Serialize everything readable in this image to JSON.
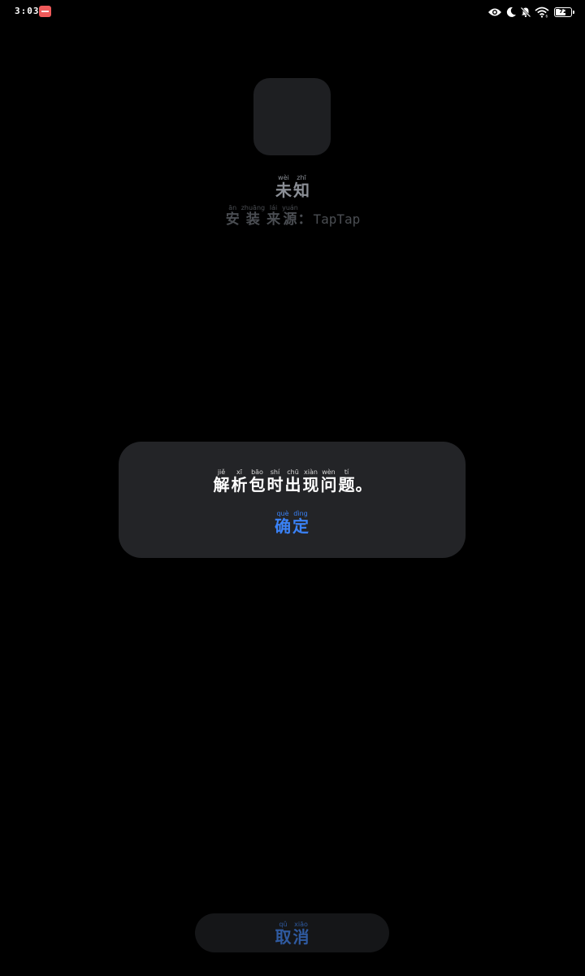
{
  "status_bar": {
    "time": "3:03",
    "notification_app_icon": "app-notification-icon",
    "icons": [
      "eye-icon",
      "moon-icon",
      "bell-off-icon",
      "wifi-icon",
      "battery-icon"
    ],
    "battery_level": "72",
    "battery_fraction": 0.72
  },
  "app": {
    "icon": "app-placeholder-icon",
    "name": [
      {
        "char": "未",
        "pinyin": "wèi"
      },
      {
        "char": "知",
        "pinyin": "zhī"
      }
    ],
    "install_source_label": [
      {
        "char": "安",
        "pinyin": "ān"
      },
      {
        "char": "装",
        "pinyin": "zhuāng"
      },
      {
        "char": "来",
        "pinyin": "lái"
      },
      {
        "char": "源",
        "pinyin": "yuán"
      }
    ],
    "install_source_separator": "：",
    "install_source_value": "TapTap"
  },
  "dialog": {
    "message": [
      {
        "char": "解",
        "pinyin": "jiě"
      },
      {
        "char": "析",
        "pinyin": "xī"
      },
      {
        "char": "包",
        "pinyin": "bāo"
      },
      {
        "char": "时",
        "pinyin": "shí"
      },
      {
        "char": "出",
        "pinyin": "chū"
      },
      {
        "char": "现",
        "pinyin": "xiàn"
      },
      {
        "char": "问",
        "pinyin": "wèn"
      },
      {
        "char": "题",
        "pinyin": "tí"
      }
    ],
    "message_end": "。",
    "confirm": [
      {
        "char": "确",
        "pinyin": "què"
      },
      {
        "char": "定",
        "pinyin": "dìng"
      }
    ]
  },
  "cancel": [
    {
      "char": "取",
      "pinyin": "qǔ"
    },
    {
      "char": "消",
      "pinyin": "xiāo"
    }
  ],
  "colors": {
    "background": "#000000",
    "dialog_background": "#232427",
    "accent_blue": "#3a82f7",
    "cancel_blue": "#2f5aa0"
  }
}
